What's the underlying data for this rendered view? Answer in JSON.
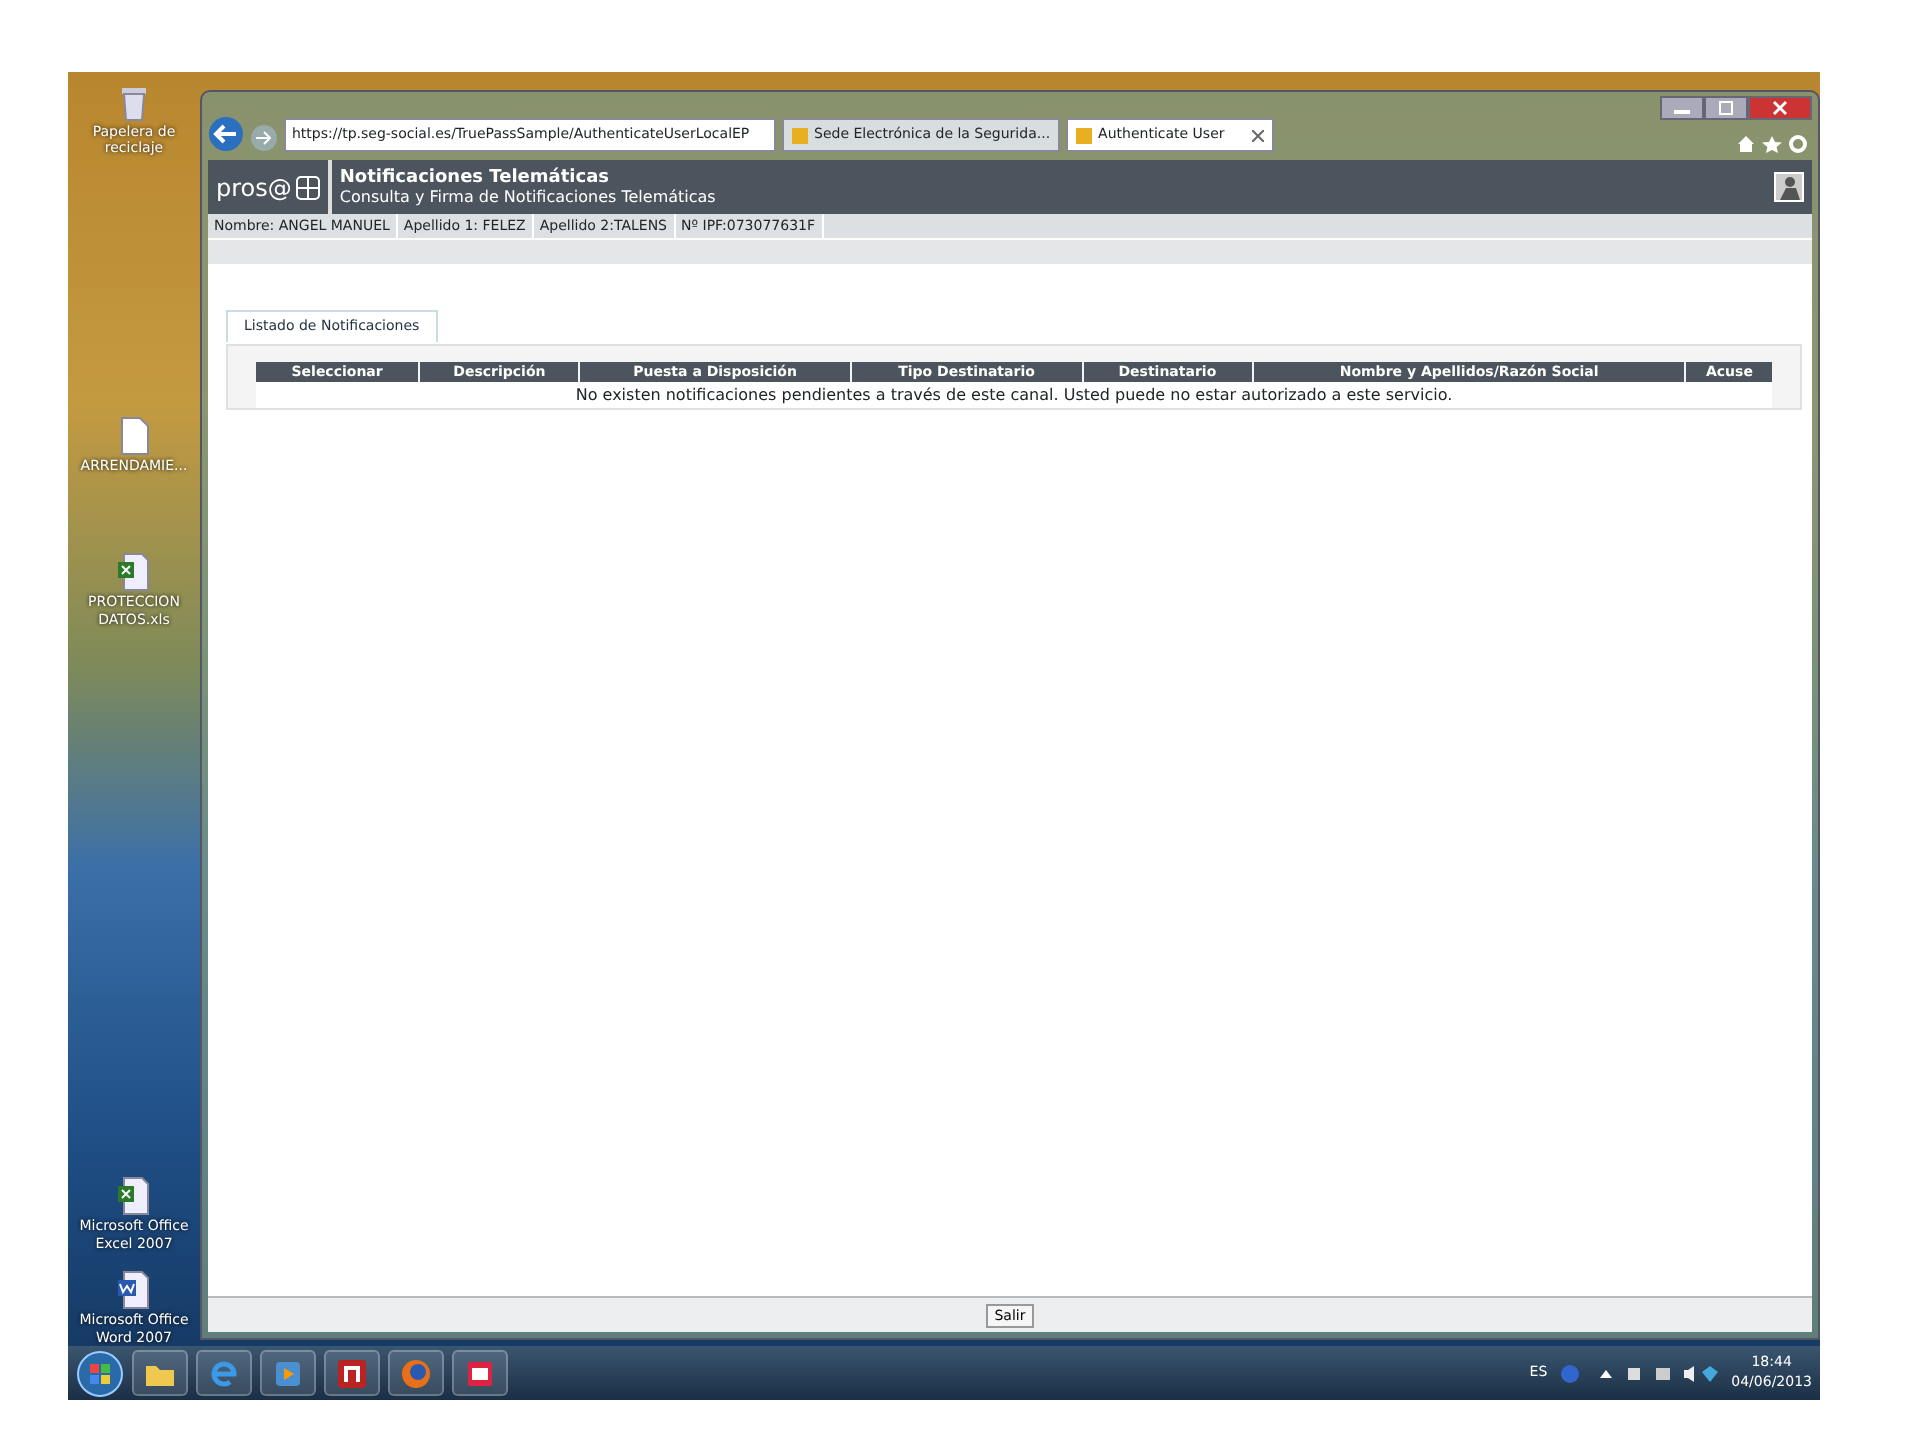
{
  "desktop_icons": [
    {
      "kind": "recycle",
      "label": "Papelera de reciclaje"
    },
    {
      "kind": "document",
      "label": "ARRENDAMIE..."
    },
    {
      "kind": "excel",
      "label": "PROTECCION DATOS.xls"
    },
    {
      "kind": "excel",
      "label": "Microsoft Office Excel 2007"
    },
    {
      "kind": "word",
      "label": "Microsoft Office Word 2007"
    }
  ],
  "browser": {
    "address": "https://tp.seg-social.es/TruePassSample/AuthenticateUserLocalEP",
    "tabs": [
      {
        "title": "Sede Electrónica de la Segurida...",
        "selected": false
      },
      {
        "title": "Authenticate User",
        "selected": true
      }
    ]
  },
  "app": {
    "logo": "pros@",
    "title": "Notificaciones Telemáticas",
    "subtitle": "Consulta y Firma de Notificaciones Telemáticas",
    "user_info": [
      "Nombre: ANGEL MANUEL",
      "Apellido 1: FELEZ",
      "Apellido 2:TALENS",
      "Nº IPF:073077631F"
    ],
    "panel_tab": "Listado de Notificaciones",
    "table": {
      "columns": [
        "Seleccionar",
        "Descripción",
        "Puesta a Disposición",
        "Tipo Destinatario",
        "Destinatario",
        "Nombre y Apellidos/Razón Social",
        "Acuse"
      ],
      "empty_message": "No existen notificaciones pendientes a través de este canal. Usted puede no estar autorizado a este servicio."
    },
    "footer_button": "Salir"
  },
  "taskbar": {
    "apps": [
      {
        "kind": "explorer"
      },
      {
        "kind": "ie"
      },
      {
        "kind": "media"
      },
      {
        "kind": "n"
      },
      {
        "kind": "firefox"
      },
      {
        "kind": "powerpoint"
      }
    ],
    "language": "ES",
    "time": "18:44",
    "date": "04/06/2013"
  }
}
